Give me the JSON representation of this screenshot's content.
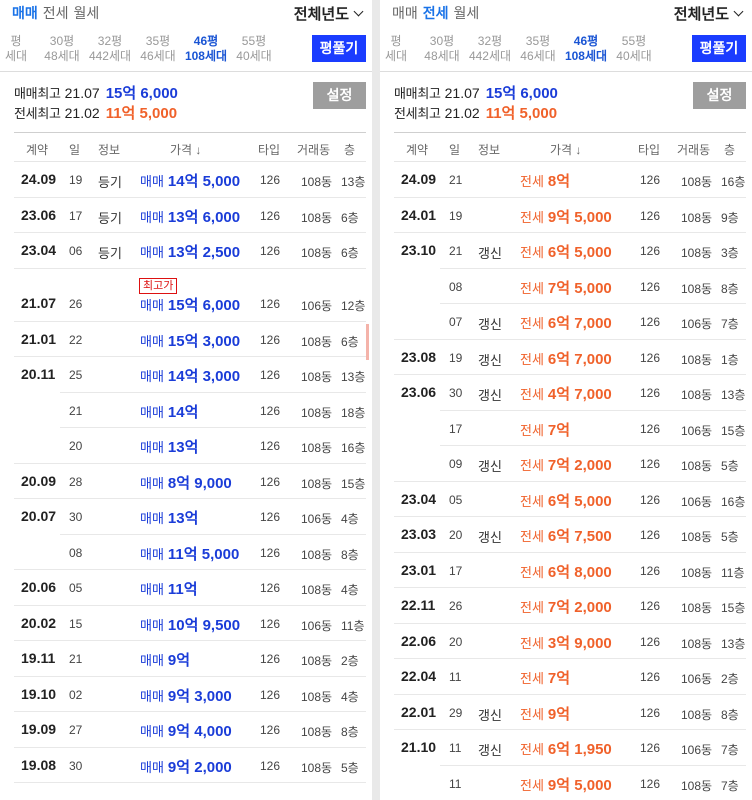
{
  "left": {
    "trade_tabs": [
      {
        "label": "매매",
        "active": true
      },
      {
        "label": "전세",
        "active": false
      },
      {
        "label": "월세",
        "active": false
      }
    ],
    "year_select": "전체년도",
    "sizes": [
      {
        "top": "평",
        "bottom": "세대",
        "active": false
      },
      {
        "top": "30평",
        "bottom": "48세대",
        "active": false
      },
      {
        "top": "32평",
        "bottom": "442세대",
        "active": false
      },
      {
        "top": "35평",
        "bottom": "46세대",
        "active": false
      },
      {
        "top": "46평",
        "bottom": "108세대",
        "active": true
      },
      {
        "top": "55평",
        "bottom": "40세대",
        "active": false
      }
    ],
    "pyeong_button": "평풀기",
    "max_sale": {
      "label": "매매최고",
      "date": "21.07",
      "price": "15억 6,000"
    },
    "max_jeonse": {
      "label": "전세최고",
      "date": "21.02",
      "price": "11억 5,000"
    },
    "settings_button": "설정",
    "headers": [
      "계약",
      "일",
      "정보",
      "가격 ↓",
      "타입",
      "거래동",
      "층"
    ],
    "rows": [
      {
        "date": "24.09",
        "day": "19",
        "info": "등기",
        "kind": "매매",
        "price": "14억 5,000",
        "type": "126",
        "dong": "108동",
        "floor": "13층"
      },
      {
        "date": "23.06",
        "day": "17",
        "info": "등기",
        "kind": "매매",
        "price": "13억 6,000",
        "type": "126",
        "dong": "108동",
        "floor": "6층"
      },
      {
        "date": "23.04",
        "day": "06",
        "info": "등기",
        "kind": "매매",
        "price": "13억 2,500",
        "type": "126",
        "dong": "108동",
        "floor": "6층"
      },
      {
        "date": "21.07",
        "day": "26",
        "info": "",
        "kind": "매매",
        "price": "15억 6,000",
        "type": "126",
        "dong": "106동",
        "floor": "12층",
        "badge": "최고가"
      },
      {
        "date": "21.01",
        "day": "22",
        "info": "",
        "kind": "매매",
        "price": "15억 3,000",
        "type": "126",
        "dong": "108동",
        "floor": "6층"
      },
      {
        "date": "20.11",
        "day": "25",
        "info": "",
        "kind": "매매",
        "price": "14억 3,000",
        "type": "126",
        "dong": "108동",
        "floor": "13층"
      },
      {
        "date": "",
        "day": "21",
        "info": "",
        "kind": "매매",
        "price": "14억",
        "type": "126",
        "dong": "108동",
        "floor": "18층"
      },
      {
        "date": "",
        "day": "20",
        "info": "",
        "kind": "매매",
        "price": "13억",
        "type": "126",
        "dong": "108동",
        "floor": "16층"
      },
      {
        "date": "20.09",
        "day": "28",
        "info": "",
        "kind": "매매",
        "price": "8억 9,000",
        "type": "126",
        "dong": "108동",
        "floor": "15층"
      },
      {
        "date": "20.07",
        "day": "30",
        "info": "",
        "kind": "매매",
        "price": "13억",
        "type": "126",
        "dong": "106동",
        "floor": "4층"
      },
      {
        "date": "",
        "day": "08",
        "info": "",
        "kind": "매매",
        "price": "11억 5,000",
        "type": "126",
        "dong": "108동",
        "floor": "8층"
      },
      {
        "date": "20.06",
        "day": "05",
        "info": "",
        "kind": "매매",
        "price": "11억",
        "type": "126",
        "dong": "108동",
        "floor": "4층"
      },
      {
        "date": "20.02",
        "day": "15",
        "info": "",
        "kind": "매매",
        "price": "10억 9,500",
        "type": "126",
        "dong": "106동",
        "floor": "11층"
      },
      {
        "date": "19.11",
        "day": "21",
        "info": "",
        "kind": "매매",
        "price": "9억",
        "type": "126",
        "dong": "108동",
        "floor": "2층"
      },
      {
        "date": "19.10",
        "day": "02",
        "info": "",
        "kind": "매매",
        "price": "9억 3,000",
        "type": "126",
        "dong": "108동",
        "floor": "4층"
      },
      {
        "date": "19.09",
        "day": "27",
        "info": "",
        "kind": "매매",
        "price": "9억 4,000",
        "type": "126",
        "dong": "108동",
        "floor": "8층"
      },
      {
        "date": "19.08",
        "day": "30",
        "info": "",
        "kind": "매매",
        "price": "9억 2,000",
        "type": "126",
        "dong": "108동",
        "floor": "5층"
      }
    ]
  },
  "right": {
    "trade_tabs": [
      {
        "label": "매매",
        "active": false
      },
      {
        "label": "전세",
        "active": true
      },
      {
        "label": "월세",
        "active": false
      }
    ],
    "year_select": "전체년도",
    "sizes": [
      {
        "top": "평",
        "bottom": "세대",
        "active": false
      },
      {
        "top": "30평",
        "bottom": "48세대",
        "active": false
      },
      {
        "top": "32평",
        "bottom": "442세대",
        "active": false
      },
      {
        "top": "35평",
        "bottom": "46세대",
        "active": false
      },
      {
        "top": "46평",
        "bottom": "108세대",
        "active": true
      },
      {
        "top": "55평",
        "bottom": "40세대",
        "active": false
      }
    ],
    "pyeong_button": "평풀기",
    "max_sale": {
      "label": "매매최고",
      "date": "21.07",
      "price": "15억 6,000"
    },
    "max_jeonse": {
      "label": "전세최고",
      "date": "21.02",
      "price": "11억 5,000"
    },
    "settings_button": "설정",
    "headers": [
      "계약",
      "일",
      "정보",
      "가격 ↓",
      "타입",
      "거래동",
      "층"
    ],
    "rows": [
      {
        "date": "24.09",
        "day": "21",
        "info": "",
        "kind": "전세",
        "price": "8억",
        "type": "126",
        "dong": "108동",
        "floor": "16층"
      },
      {
        "date": "24.01",
        "day": "19",
        "info": "",
        "kind": "전세",
        "price": "9억 5,000",
        "type": "126",
        "dong": "108동",
        "floor": "9층"
      },
      {
        "date": "23.10",
        "day": "21",
        "info": "갱신",
        "kind": "전세",
        "price": "6억 5,000",
        "type": "126",
        "dong": "108동",
        "floor": "3층"
      },
      {
        "date": "",
        "day": "08",
        "info": "",
        "kind": "전세",
        "price": "7억 5,000",
        "type": "126",
        "dong": "108동",
        "floor": "8층"
      },
      {
        "date": "",
        "day": "07",
        "info": "갱신",
        "kind": "전세",
        "price": "6억 7,000",
        "type": "126",
        "dong": "106동",
        "floor": "7층"
      },
      {
        "date": "23.08",
        "day": "19",
        "info": "갱신",
        "kind": "전세",
        "price": "6억 7,000",
        "type": "126",
        "dong": "108동",
        "floor": "1층"
      },
      {
        "date": "23.06",
        "day": "30",
        "info": "갱신",
        "kind": "전세",
        "price": "4억 7,000",
        "type": "126",
        "dong": "108동",
        "floor": "13층"
      },
      {
        "date": "",
        "day": "17",
        "info": "",
        "kind": "전세",
        "price": "7억",
        "type": "126",
        "dong": "106동",
        "floor": "15층"
      },
      {
        "date": "",
        "day": "09",
        "info": "갱신",
        "kind": "전세",
        "price": "7억 2,000",
        "type": "126",
        "dong": "108동",
        "floor": "5층"
      },
      {
        "date": "23.04",
        "day": "05",
        "info": "",
        "kind": "전세",
        "price": "6억 5,000",
        "type": "126",
        "dong": "106동",
        "floor": "16층"
      },
      {
        "date": "23.03",
        "day": "20",
        "info": "갱신",
        "kind": "전세",
        "price": "6억 7,500",
        "type": "126",
        "dong": "108동",
        "floor": "5층"
      },
      {
        "date": "23.01",
        "day": "17",
        "info": "",
        "kind": "전세",
        "price": "6억 8,000",
        "type": "126",
        "dong": "108동",
        "floor": "11층"
      },
      {
        "date": "22.11",
        "day": "26",
        "info": "",
        "kind": "전세",
        "price": "7억 2,000",
        "type": "126",
        "dong": "108동",
        "floor": "15층"
      },
      {
        "date": "22.06",
        "day": "20",
        "info": "",
        "kind": "전세",
        "price": "3억 9,000",
        "type": "126",
        "dong": "108동",
        "floor": "13층"
      },
      {
        "date": "22.04",
        "day": "11",
        "info": "",
        "kind": "전세",
        "price": "7억",
        "type": "126",
        "dong": "106동",
        "floor": "2층"
      },
      {
        "date": "22.01",
        "day": "29",
        "info": "갱신",
        "kind": "전세",
        "price": "9억",
        "type": "126",
        "dong": "108동",
        "floor": "8층"
      },
      {
        "date": "21.10",
        "day": "11",
        "info": "갱신",
        "kind": "전세",
        "price": "6억 1,950",
        "type": "126",
        "dong": "106동",
        "floor": "7층"
      },
      {
        "date": "",
        "day": "11",
        "info": "",
        "kind": "전세",
        "price": "9억 5,000",
        "type": "126",
        "dong": "108동",
        "floor": "7층"
      }
    ]
  },
  "colors": {
    "sale": "#1a3cd8",
    "jeonse": "#f0612a",
    "accent_button": "#1a3cff",
    "badge": "#dd1111"
  }
}
